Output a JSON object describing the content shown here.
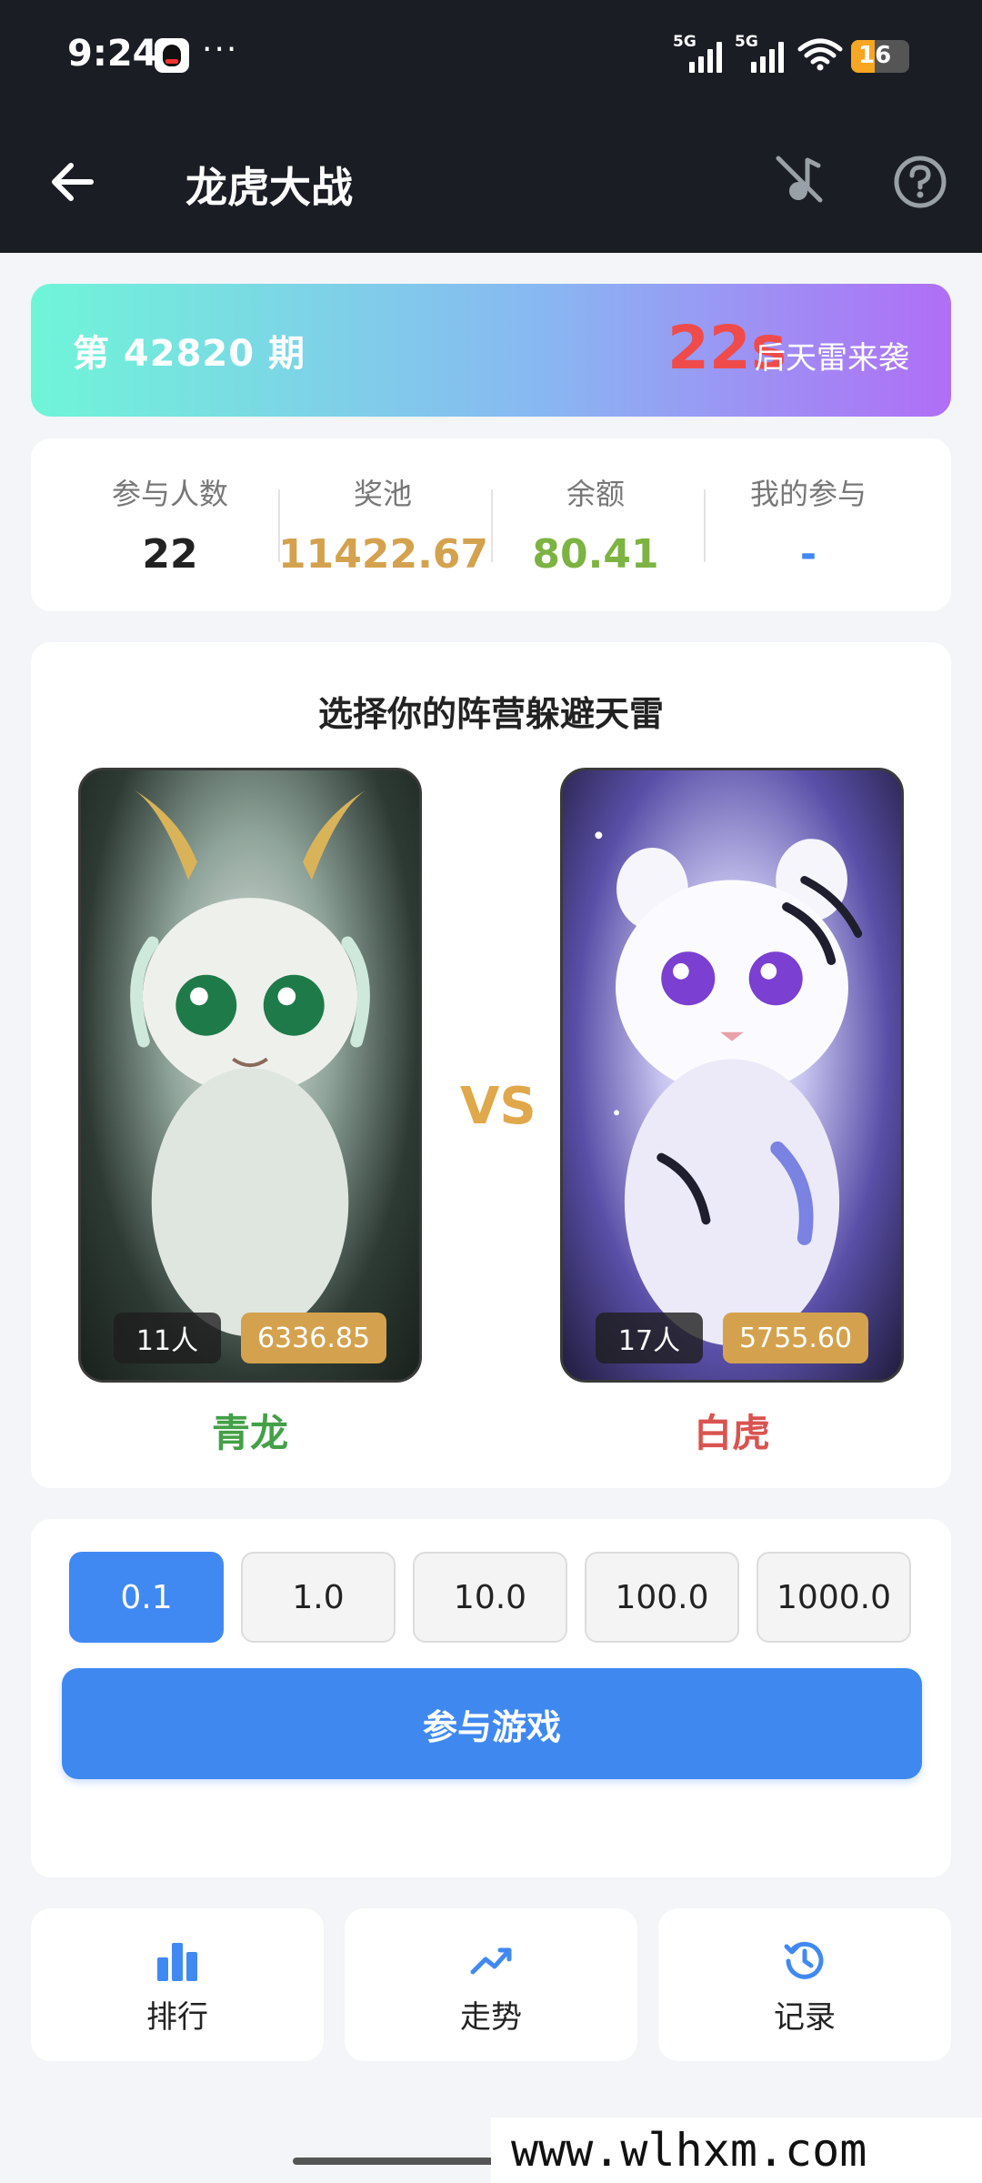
{
  "status_bar": {
    "time": "9:24",
    "more": "···",
    "network_1": "5G",
    "network_2": "5G",
    "battery": "16",
    "icons": [
      "qq-icon",
      "signal-icon",
      "wifi-icon",
      "battery-icon"
    ]
  },
  "header": {
    "title": "龙虎大战",
    "icons": [
      "back-arrow-icon",
      "music-off-icon",
      "help-icon"
    ]
  },
  "period": {
    "issue_label": "第 42820 期",
    "countdown": "22s",
    "countdown_suffix": "后天雷来袭"
  },
  "stats": [
    {
      "label": "参与人数",
      "value": "22",
      "color": "#222222"
    },
    {
      "label": "奖池",
      "value": "11422.67",
      "color": "#d4a24e"
    },
    {
      "label": "余额",
      "value": "80.41",
      "color": "#7cb342"
    },
    {
      "label": "我的参与",
      "value": "-",
      "color": "#4189f2"
    }
  ],
  "faction": {
    "heading": "选择你的阵营躲避天雷",
    "vs": "VS",
    "dragon": {
      "count": "11人",
      "pool": "6336.85",
      "name": "青龙",
      "color": "#43a047"
    },
    "tiger": {
      "count": "17人",
      "pool": "5755.60",
      "name": "白虎",
      "color": "#d9534f"
    }
  },
  "bet": {
    "amounts": [
      "0.1",
      "1.0",
      "10.0",
      "100.0",
      "1000.0"
    ],
    "selected": "0.1",
    "join_label": "参与游戏"
  },
  "tabs": [
    {
      "label": "排行",
      "icon": "bar-chart-icon"
    },
    {
      "label": "走势",
      "icon": "trend-icon"
    },
    {
      "label": "记录",
      "icon": "history-icon"
    }
  ],
  "watermark": "www.wlhxm.com",
  "colors": {
    "accent": "#4189f2",
    "gold": "#d4a24e",
    "countdown": "#ef4b4b"
  }
}
